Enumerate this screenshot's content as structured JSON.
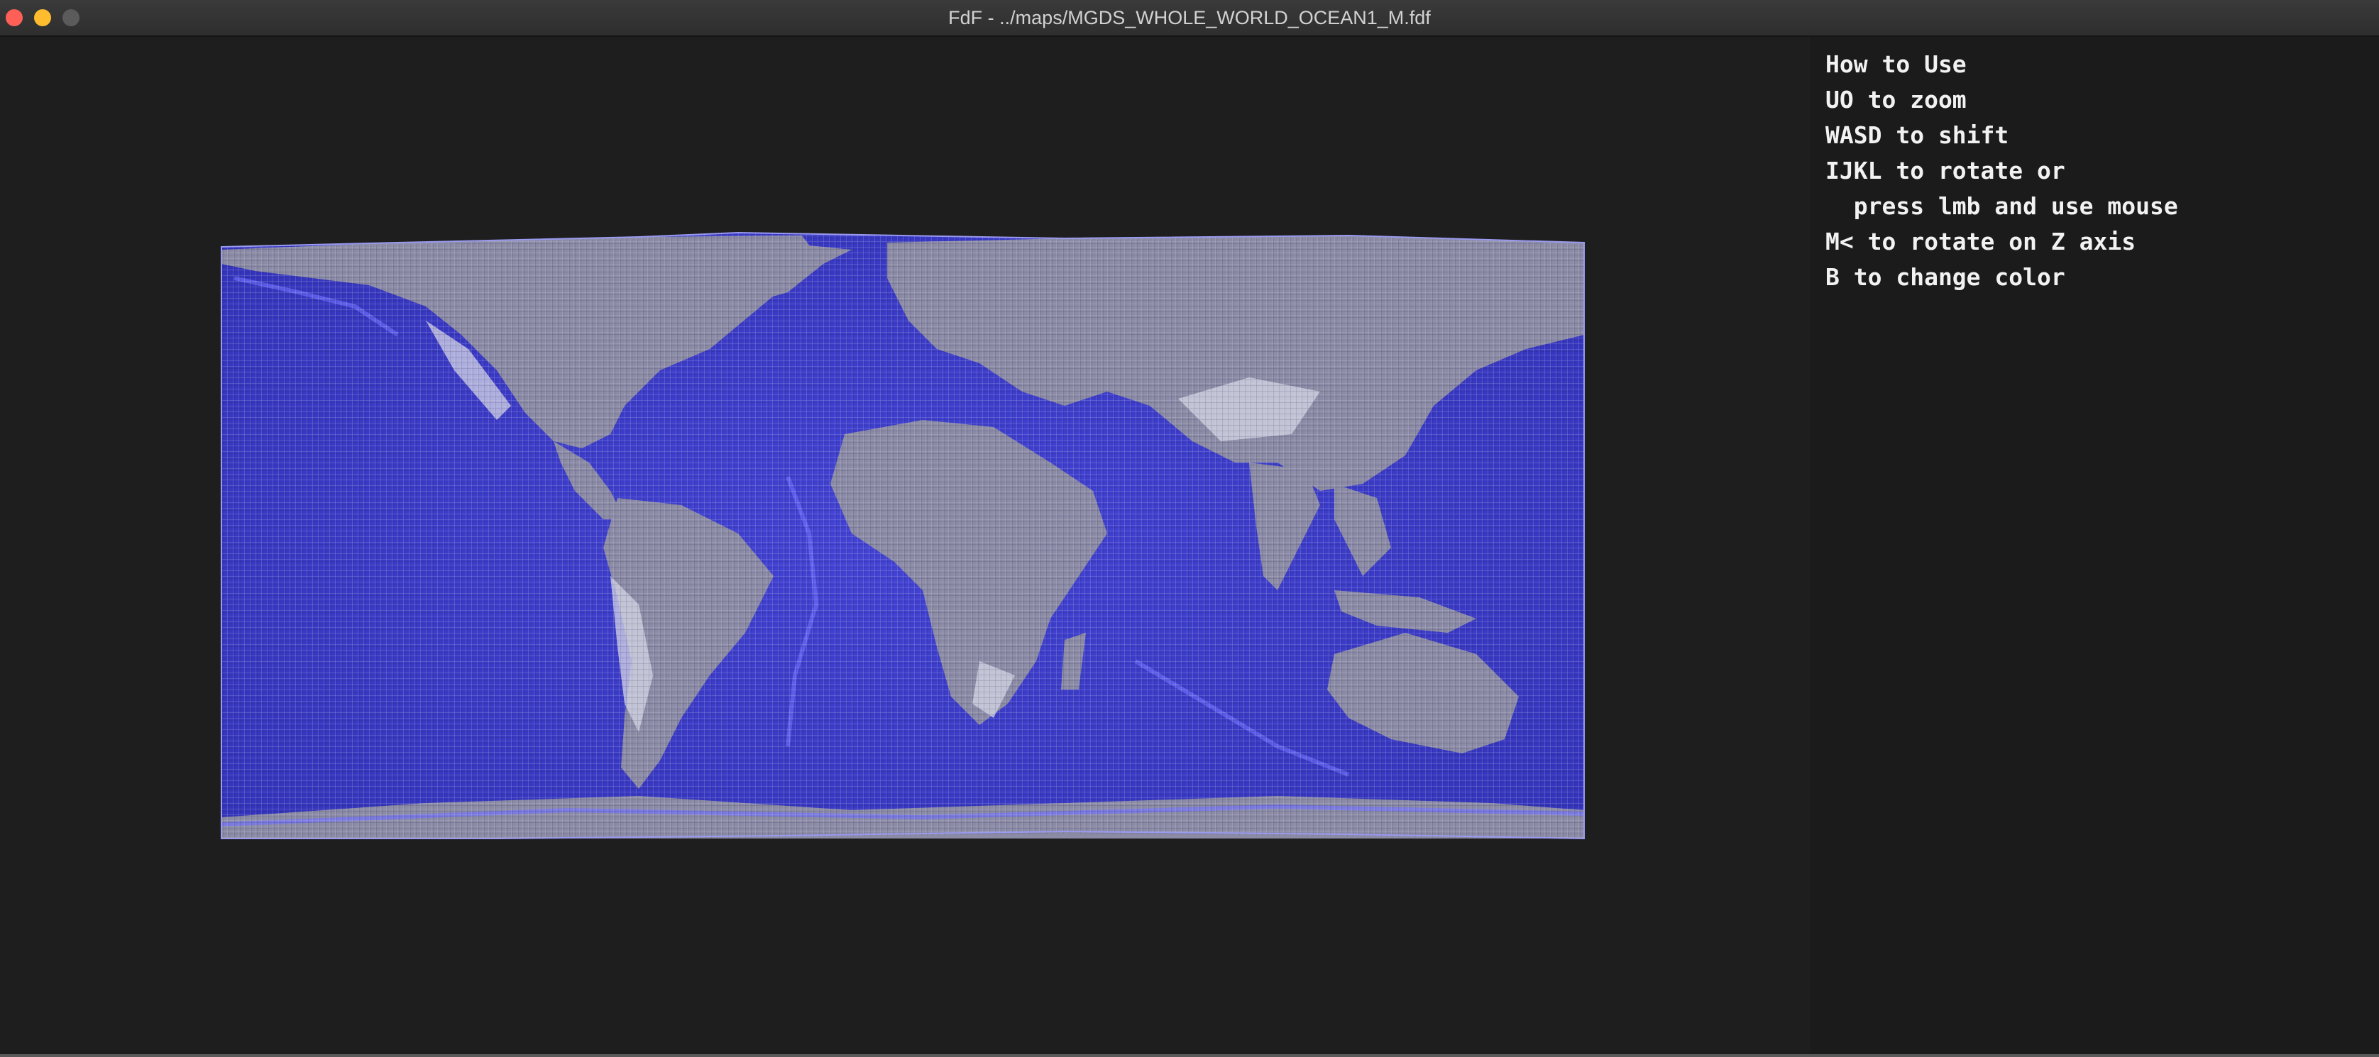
{
  "window": {
    "title": "FdF - ../maps/MGDS_WHOLE_WORLD_OCEAN1_M.fdf",
    "buttons": [
      "close-icon",
      "minimize-icon",
      "maximize-icon"
    ]
  },
  "help": {
    "lines": [
      "How to Use",
      "UO to zoom",
      "WASD to shift",
      "IJKL to rotate or",
      "  press lmb and use mouse",
      "M< to rotate on Z axis",
      "B to change color"
    ]
  },
  "render": {
    "map_name": "MGDS_WHOLE_WORLD_OCEAN1_M",
    "colors": {
      "ocean": "#3a3acc",
      "ocean_light": "#6f6ff5",
      "land": "#8a8aa8",
      "land_light": "#c8c8d8",
      "background": "#1e1e1e"
    }
  }
}
